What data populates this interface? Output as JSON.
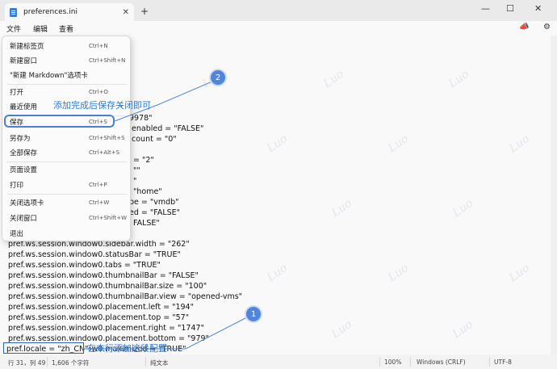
{
  "tab": {
    "title": "preferences.ini",
    "close": "✕"
  },
  "new_tab": "+",
  "window": {
    "minimize": "—",
    "maximize": "☐",
    "close": "✕"
  },
  "menubar": {
    "file": "文件",
    "edit": "编辑",
    "view": "查看"
  },
  "dropdown": {
    "items": [
      {
        "label": "新建标签页",
        "shortcut": "Ctrl+N"
      },
      {
        "label": "新建窗口",
        "shortcut": "Ctrl+Shift+N"
      },
      {
        "label": "\"新建 Markdown\"选项卡",
        "shortcut": ""
      },
      {
        "label": "打开",
        "shortcut": "Ctrl+O"
      },
      {
        "label": "最近使用",
        "shortcut": ""
      },
      {
        "label": "保存",
        "shortcut": "Ctrl+S"
      },
      {
        "label": "另存为",
        "shortcut": "Ctrl+Shift+S"
      },
      {
        "label": "全部保存",
        "shortcut": "Ctrl+Alt+S"
      },
      {
        "label": "页面设置",
        "shortcut": ""
      },
      {
        "label": "打印",
        "shortcut": "Ctrl+P"
      },
      {
        "label": "关闭选项卡",
        "shortcut": "Ctrl+W"
      },
      {
        "label": "关闭窗口",
        "shortcut": "Ctrl+Shift+W"
      },
      {
        "label": "退出",
        "shortcut": ""
      }
    ],
    "recent_arrow": "›"
  },
  "editor": {
    "lines": [
      "9978\"",
      ".enabled = \"FALSE\"",
      ".count = \"0\"",
      "= \"2\"",
      "\"\"",
      "\"",
      "\"home\"",
      "pe = \"vmdb\"",
      "ed = \"FALSE\"",
      "FALSE\"",
      "pref.ws.session.window0.sidebar.width = \"262\"",
      "pref.ws.session.window0.statusBar = \"TRUE\"",
      "pref.ws.session.window0.tabs = \"TRUE\"",
      "pref.ws.session.window0.thumbnailBar = \"FALSE\"",
      "pref.ws.session.window0.thumbnailBar.size = \"100\"",
      "pref.ws.session.window0.thumbnailBar.view = \"opened-vms\"",
      "pref.ws.session.window0.placement.left = \"194\"",
      "pref.ws.session.window0.placement.top = \"57\"",
      "pref.ws.session.window0.placement.right = \"1747\"",
      "pref.ws.session.window0.placement.bottom = \"979\"",
      "pref.ws.session.window0.maximized = \"TRUE\"",
      "pref.locale = \"zh_CN\""
    ]
  },
  "annotations": {
    "badge1": "1",
    "badge2": "2",
    "note1": "在末行添加这段配置",
    "note2": "添加完成后保存关闭即可"
  },
  "watermark": "Luo",
  "statusbar": {
    "position": "行 31，列 49",
    "chars": "1,606 个字符",
    "format": "纯文本",
    "zoom": "100%",
    "line_ending": "Windows (CRLF)",
    "encoding": "UTF-8"
  },
  "colors": {
    "accent": "#4f86dc",
    "annotation_text": "#2d7dd2",
    "box": "#2e62b8"
  }
}
